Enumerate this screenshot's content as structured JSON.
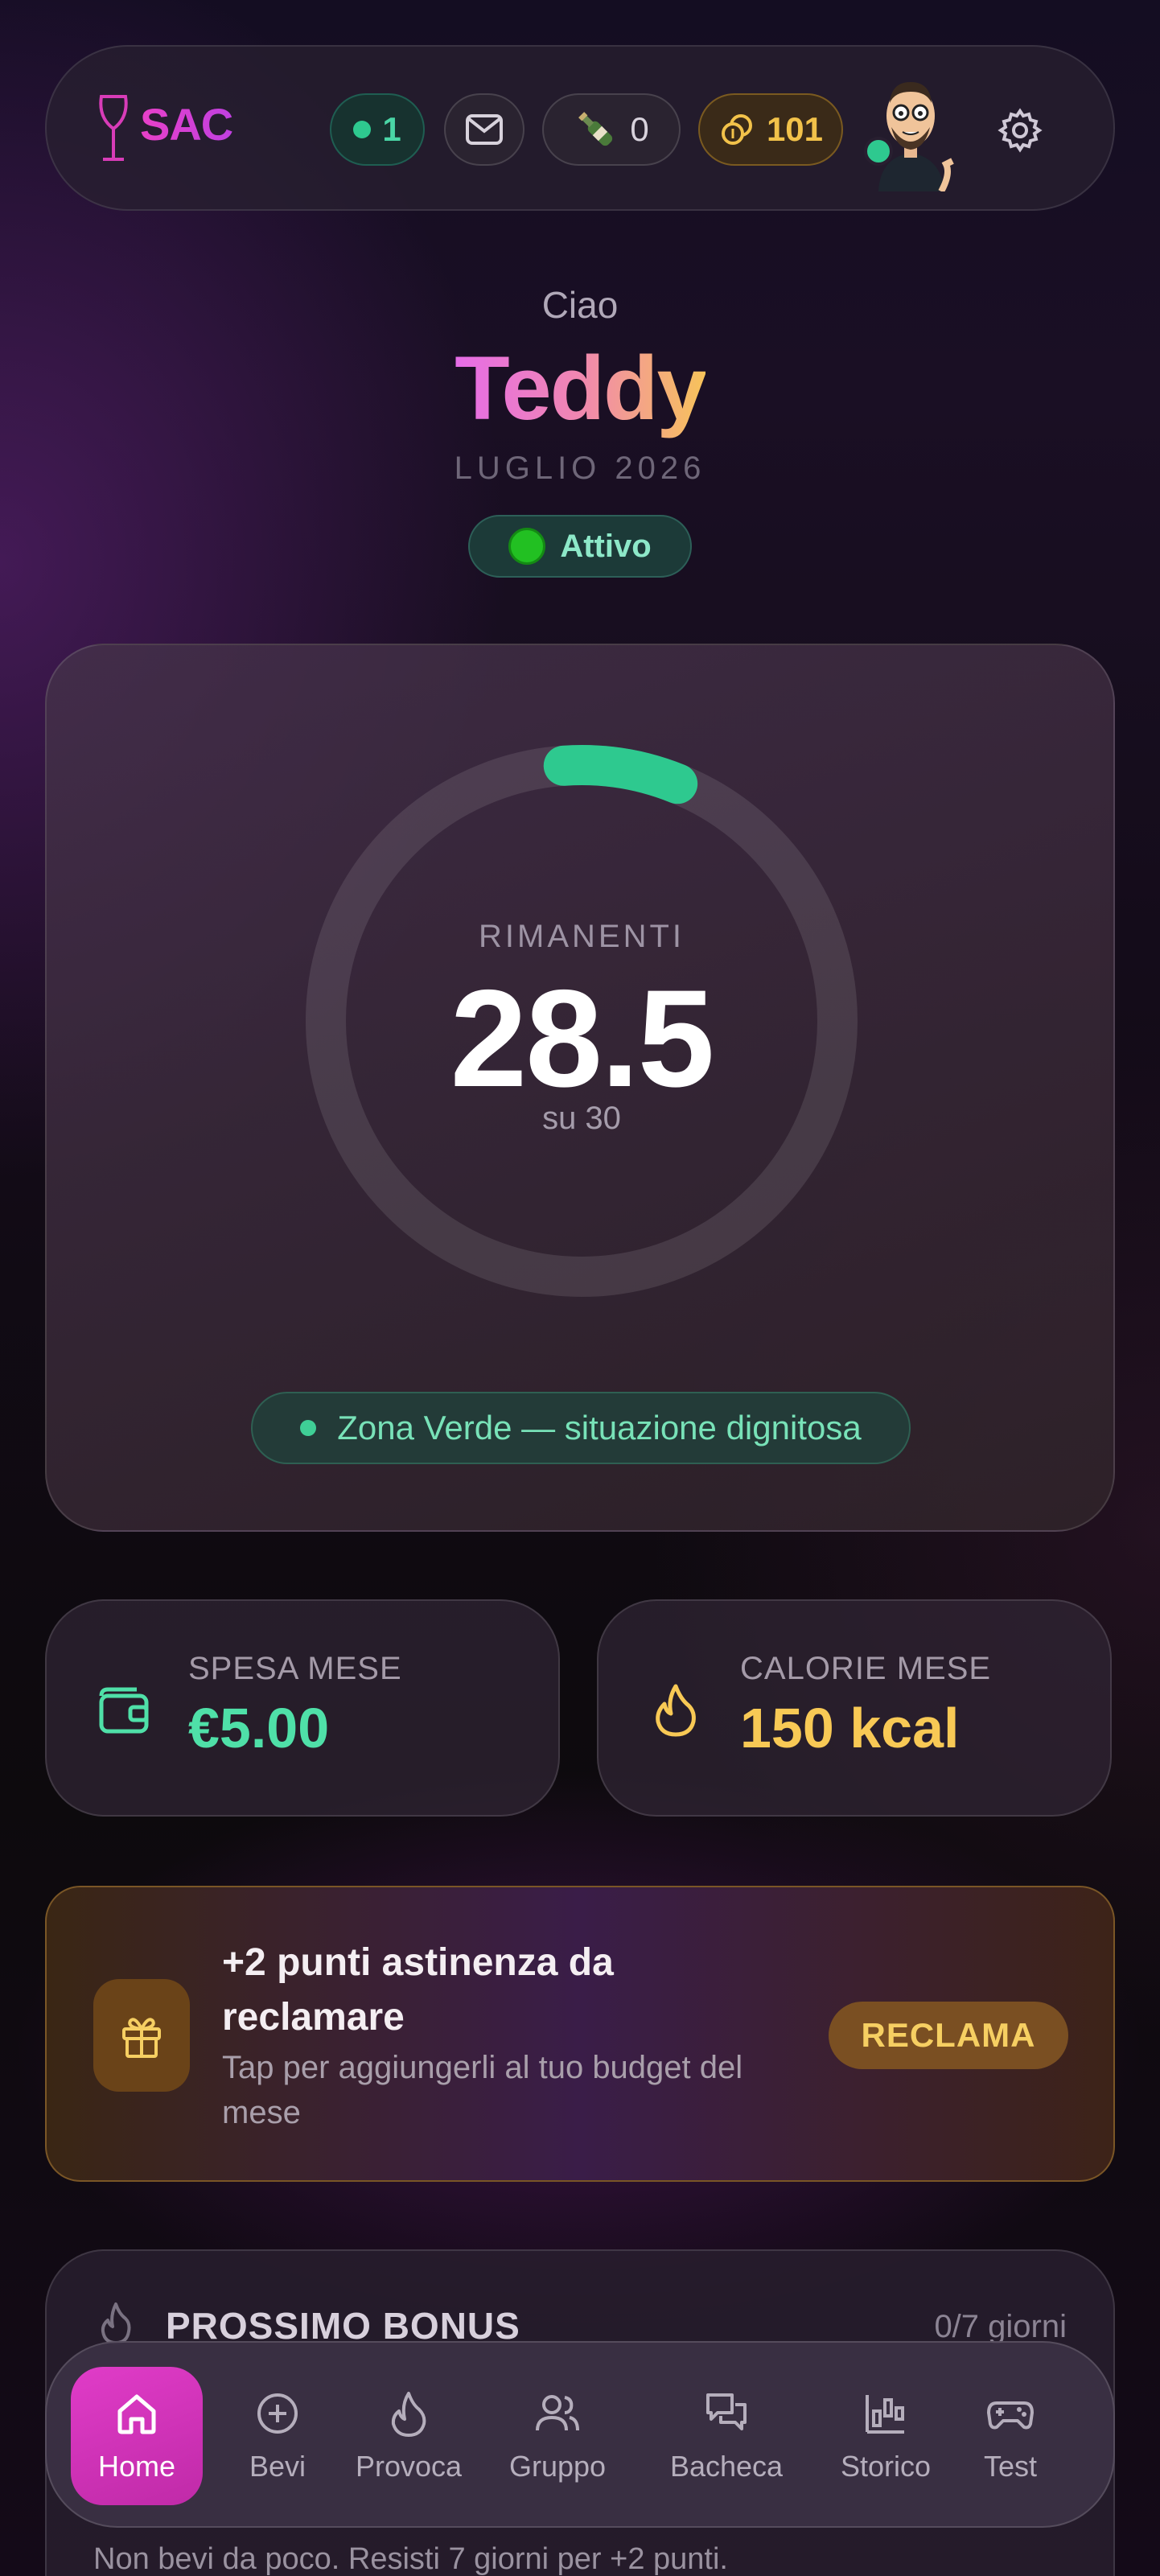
{
  "header": {
    "logo_text": "SAC",
    "online_count": "1",
    "bottle_count": "0",
    "coins": "101",
    "icons": [
      "wine-glass-icon",
      "mail-icon",
      "bottle-icon",
      "coins-icon",
      "gear-icon"
    ]
  },
  "greeting": {
    "hello": "Ciao",
    "name": "Teddy",
    "month": "LUGLIO 2026",
    "status": "Attivo"
  },
  "budget": {
    "label": "RIMANENTI",
    "remaining": "28.5",
    "total_text": "su 30",
    "zone": "Zona Verde — situazione dignitosa",
    "used_fraction": 0.05,
    "ring_color": "#2ec98f"
  },
  "stats": {
    "spend_label": "SPESA MESE",
    "spend_value": "€5.00",
    "spend_color": "#4fe0a8",
    "calories_label": "CALORIE MESE",
    "calories_value": "150 kcal",
    "calories_color": "#f8c955"
  },
  "claim": {
    "title": "+2 punti astinenza da reclamare",
    "subtitle": "Tap per aggiungerli al tuo budget del mese",
    "button": "RECLAMA"
  },
  "bonus": {
    "title": "PROSSIMO BONUS",
    "progress": "0/7 giorni",
    "description": "Non bevi da poco. Resisti 7 giorni per +2 punti."
  },
  "nav": {
    "home": "Home",
    "bevi": "Bevi",
    "provoca": "Provoca",
    "gruppo": "Gruppo",
    "bacheca": "Bacheca",
    "storico": "Storico",
    "test": "Test"
  },
  "colors": {
    "accent_pink": "#e03cc8",
    "accent_green": "#2ec98f",
    "accent_gold": "#f2c24a"
  }
}
